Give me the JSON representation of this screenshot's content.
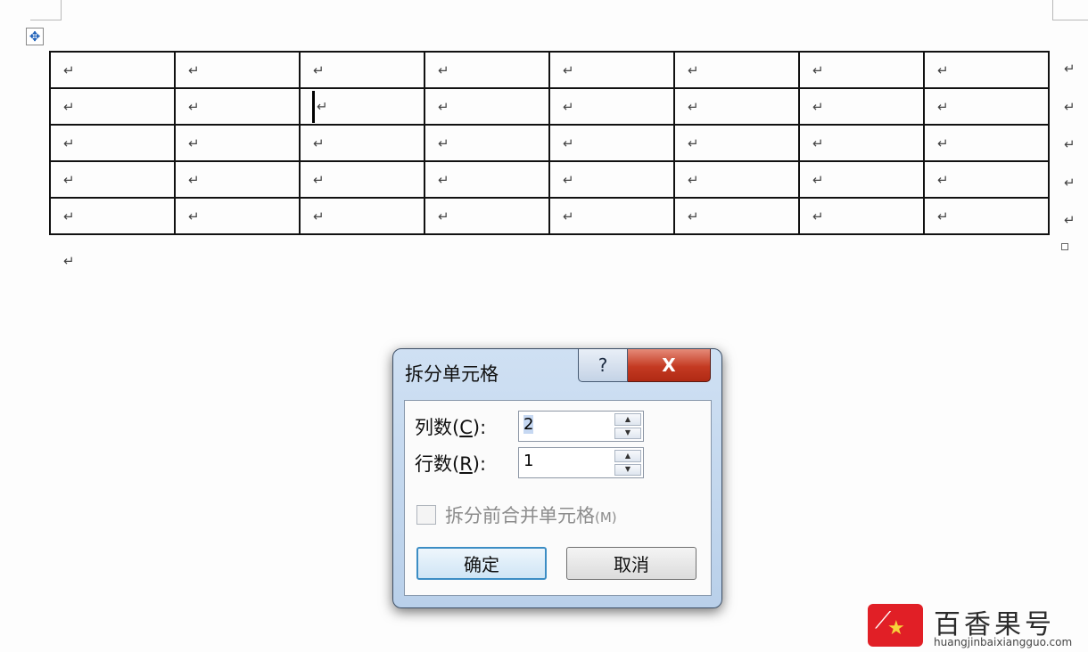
{
  "document": {
    "paragraph_mark": "↵",
    "move_handle_icon": "four-arrow-move-icon",
    "columns": 8,
    "rows": 5,
    "cursor_cell": {
      "row": 2,
      "col": 3
    }
  },
  "dialog": {
    "title": "拆分单元格",
    "help_label": "?",
    "close_label": "X",
    "columns_label": "列数",
    "columns_hotkey": "C",
    "columns_value": "2",
    "rows_label": "行数",
    "rows_hotkey": "R",
    "rows_value": "1",
    "merge_label": "拆分前合并单元格",
    "merge_hotkey": "(M)",
    "merge_checked": false,
    "ok_label": "确定",
    "cancel_label": "取消"
  },
  "watermark": {
    "name": "百香果号",
    "url": "huangjinbaixiangguo.com",
    "accent_color": "#e11f26"
  }
}
